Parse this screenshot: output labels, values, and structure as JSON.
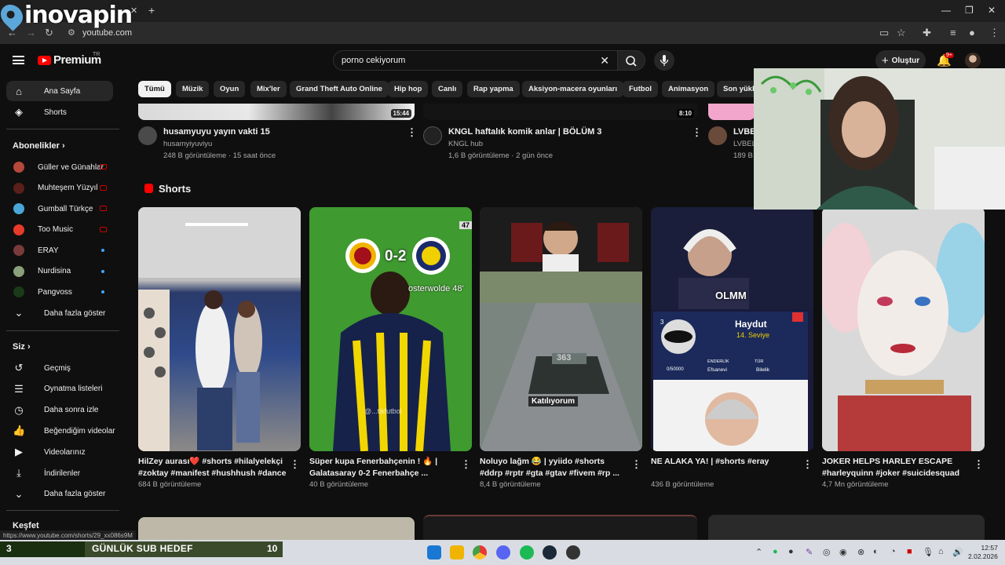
{
  "browser": {
    "overlay_brand": "inovapin",
    "url": "youtube.com",
    "status_url": "https://www.youtube.com/shorts/29_xx086s9M"
  },
  "header": {
    "logo_text": "Premium",
    "logo_superscript": "TR",
    "search_query": "porno cekiyorum",
    "create_label": "Oluştur",
    "notif_badge": "9+"
  },
  "sidebar": {
    "main": [
      {
        "label": "Ana Sayfa",
        "icon": "home-icon"
      },
      {
        "label": "Shorts",
        "icon": "shorts-icon"
      }
    ],
    "subs_heading": "Abonelikler",
    "subs": [
      {
        "label": "Güller ve Günahlar",
        "color": "#b5483a",
        "live": true
      },
      {
        "label": "Muhteşem Yüzyıl",
        "color": "#5a1f1a",
        "live": true
      },
      {
        "label": "Gumball Türkçe",
        "color": "#4aa6d8",
        "live": true
      },
      {
        "label": "Too Music",
        "color": "#e83a2a",
        "live": true
      },
      {
        "label": "ERAY",
        "color": "#7a3a3a",
        "live": false
      },
      {
        "label": "Nurdisina",
        "color": "#8aa07a",
        "live": false
      },
      {
        "label": "Pangvoss",
        "color": "#1a3a1a",
        "live": false
      }
    ],
    "subs_more": "Daha fazla göster",
    "you_heading": "Siz",
    "you": [
      {
        "label": "Geçmiş",
        "icon": "history-icon"
      },
      {
        "label": "Oynatma listeleri",
        "icon": "playlists-icon"
      },
      {
        "label": "Daha sonra izle",
        "icon": "watch-later-icon"
      },
      {
        "label": "Beğendiğim videolar",
        "icon": "like-icon"
      },
      {
        "label": "Videolarınız",
        "icon": "your-videos-icon"
      },
      {
        "label": "İndirilenler",
        "icon": "download-icon"
      },
      {
        "label": "Daha fazla göster",
        "icon": "chevron-down-icon"
      }
    ],
    "explore_heading": "Keşfet"
  },
  "chips": [
    "Tümü",
    "Müzik",
    "Oyun",
    "Mix'ler",
    "Grand Theft Auto Online",
    "Hip hop",
    "Canlı",
    "Rap yapma",
    "Aksiyon-macera oyunları",
    "Futbol",
    "Animasyon",
    "Son yükle"
  ],
  "videos": [
    {
      "title": "husamyuyu yayın vakti 15",
      "channel": "husamyiyuviyu",
      "meta": "248 B görüntüleme · 15 saat önce",
      "duration": "15:44"
    },
    {
      "title": "KNGL haftalık komik anlar | BÖLÜM 3",
      "channel": "KNGL hub",
      "meta": "1,6 B görüntüleme · 2 gün önce",
      "duration": "8:10"
    },
    {
      "title": "LVBEL",
      "channel": "LVBEL",
      "meta": "189 B",
      "duration": ""
    }
  ],
  "shorts": {
    "heading": "Shorts",
    "items": [
      {
        "title": "HilZey aurası❤️ #shorts #hilalyelekçi #zoktay #manifest #hushhush #dance",
        "views": "684 B görüntüleme"
      },
      {
        "title": "Süper kupa Fenerbahçenin ! 🔥 | Galatasaray 0-2 Fenerbahçe ...",
        "views": "40 B görüntüleme",
        "overlay_score": "0-2",
        "overlay_scorer": "osterwolde 48'",
        "overlay_watermark": "@...tikfutbol",
        "badge": "47"
      },
      {
        "title": "Noluyo lağm 😂 | yyiido #shorts #ddrp #rptr #gta #gtav #fivem #rp ...",
        "views": "8,4 B görüntüleme",
        "overlay_caption": "Katılıyorum",
        "plate": "363"
      },
      {
        "title": "NE ALAKA YA! | #shorts #eray",
        "views": "436 B görüntüleme",
        "overlay_name": "OLMM",
        "overlay_card_title": "Haydut",
        "overlay_card_sub": "14. Seviye",
        "overlay_tag1": "ENDERLİK",
        "overlay_tag2": "Efsanevi",
        "overlay_tag3": "TÜR",
        "overlay_tag4": "Bilelik",
        "overlay_count": "0/50000",
        "overlay_badge_num": "3"
      },
      {
        "title": "JOKER HELPS HARLEY ESCAPE #harleyquinn #joker #suicidesquad",
        "views": "4,7 Mn görüntüleme"
      }
    ]
  },
  "stream_overlay": {
    "goal_current": "3",
    "goal_label": "GÜNLÜK SUB HEDEF",
    "goal_target": "10",
    "goal_progress": 0.3
  },
  "taskbar": {
    "time": "12:57",
    "date": "2.02.2026"
  }
}
